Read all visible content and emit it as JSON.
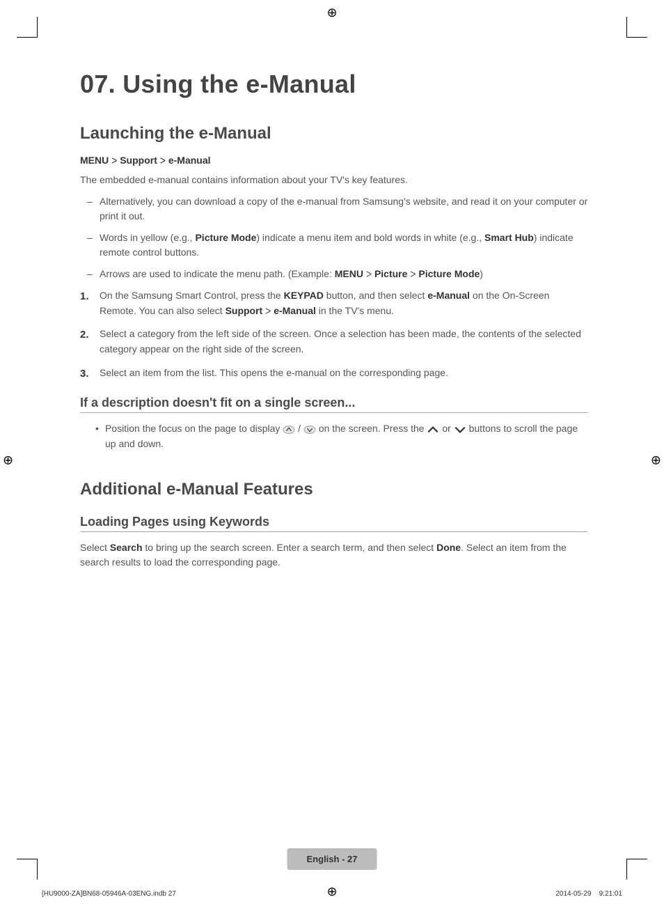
{
  "chapter": {
    "title": "07. Using the e-Manual"
  },
  "sections": {
    "launch": {
      "heading": "Launching the e-Manual",
      "menupath": {
        "a": "MENU",
        "b": "Support",
        "c": "e-Manual"
      },
      "intro": "The embedded e-manual contains information about your TV's key features.",
      "dashes": {
        "d1": "Alternatively, you can download a copy of the e-manual from Samsung's website, and read it on your computer or print it out.",
        "d2a": "Words in yellow (e.g., ",
        "d2b": "Picture Mode",
        "d2c": ") indicate a menu item and bold words in white (e.g., ",
        "d2d": "Smart Hub",
        "d2e": ") indicate remote control buttons.",
        "d3a": "Arrows are used to indicate the menu path. (Example: ",
        "d3b": "MENU",
        "d3c": "Picture",
        "d3d": "Picture Mode",
        "d3e": ")"
      },
      "steps": {
        "s1a": "On the Samsung Smart Control, press the ",
        "s1b": "KEYPAD",
        "s1c": " button, and then select ",
        "s1d": "e-Manual",
        "s1e": " on the On-Screen Remote. You can also select ",
        "s1f": "Support",
        "s1g": "e-Manual",
        "s1h": " in the TV's menu.",
        "s2": "Select a category from the left side of the screen. Once a selection has been made, the contents of the selected category appear on the right side of the screen.",
        "s3": "Select an item from the list. This opens the e-manual on the corresponding page.",
        "n1": "1.",
        "n2": "2.",
        "n3": "3."
      },
      "subsection": {
        "heading": "If a description doesn't fit on a single screen...",
        "b1a": "Position the focus on the page to display ",
        "b1b": " / ",
        "b1c": " on the screen. Press the ",
        "b1d": " or ",
        "b1e": " buttons to scroll the page up and down."
      }
    },
    "additional": {
      "heading": "Additional e-Manual Features",
      "loading": {
        "heading": "Loading Pages using Keywords",
        "p1a": "Select ",
        "p1b": "Search",
        "p1c": " to bring up the search screen. Enter a search term, and then select ",
        "p1d": "Done",
        "p1e": ". Select an item from the search results to load the corresponding page."
      }
    }
  },
  "footer": {
    "badge_lang": "English - ",
    "badge_num": "27",
    "slug_left": "[HU9000-ZA]BN68-05946A-03ENG.indb   27",
    "slug_right": "2014-05-29      9:21:01"
  },
  "glyphs": {
    "chevron": ">"
  }
}
